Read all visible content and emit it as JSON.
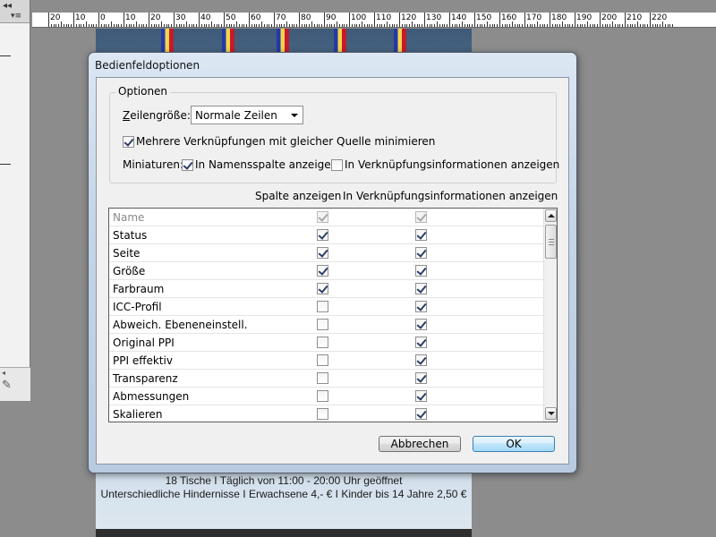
{
  "app": {
    "ruler_ticks": [
      "20",
      "10",
      "0",
      "10",
      "20",
      "30",
      "40",
      "50",
      "60",
      "70",
      "80",
      "90",
      "100",
      "110",
      "120",
      "130",
      "140",
      "150",
      "160",
      "170",
      "180",
      "190",
      "200",
      "210",
      "220"
    ],
    "panel_collapse_glyph": "◂◂",
    "panel_menu_glyph": "▾≡",
    "page_lines": [
      "18 Tische I Täglich von 11:00 - 20:00 Uhr geöffnet",
      "Unterschiedliche Hindernisse I Erwachsene 4,- € I Kinder bis 14 Jahre 2,50 €"
    ]
  },
  "dialog": {
    "title": "Bedienfeldoptionen",
    "options_group": {
      "legend": "Optionen",
      "row_size_label_access": "Z",
      "row_size_label_rest": "eilengröße:",
      "row_size_value": "Normale Zeilen",
      "minimize_links_label": "Mehrere Verknüpfungen mit gleicher Quelle minimieren",
      "minimize_links_checked": true,
      "thumbnails_label": "Miniaturen:",
      "thumb_name_column_label": "In Namensspalte anzeigen",
      "thumb_name_column_checked": true,
      "thumb_link_info_label": "In Verknüpfungsinformationen anzeigen",
      "thumb_link_info_checked": false
    },
    "columns": {
      "show_column": "Spalte anzeigen",
      "show_in_link_info": "In Verknüpfungsinformationen anzeigen"
    },
    "rows": [
      {
        "name": "Name",
        "show_column": true,
        "show_info": true,
        "disabled": true
      },
      {
        "name": "Status",
        "show_column": true,
        "show_info": true,
        "disabled": false
      },
      {
        "name": "Seite",
        "show_column": true,
        "show_info": true,
        "disabled": false
      },
      {
        "name": "Größe",
        "show_column": true,
        "show_info": true,
        "disabled": false
      },
      {
        "name": "Farbraum",
        "show_column": true,
        "show_info": true,
        "disabled": false
      },
      {
        "name": "ICC-Profil",
        "show_column": false,
        "show_info": true,
        "disabled": false
      },
      {
        "name": "Abweich. Ebeneneinstell.",
        "show_column": false,
        "show_info": true,
        "disabled": false
      },
      {
        "name": "Original PPI",
        "show_column": false,
        "show_info": true,
        "disabled": false
      },
      {
        "name": "PPI effektiv",
        "show_column": false,
        "show_info": true,
        "disabled": false
      },
      {
        "name": "Transparenz",
        "show_column": false,
        "show_info": true,
        "disabled": false
      },
      {
        "name": "Abmessungen",
        "show_column": false,
        "show_info": true,
        "disabled": false
      },
      {
        "name": "Skalieren",
        "show_column": false,
        "show_info": true,
        "disabled": false
      }
    ],
    "buttons": {
      "cancel": "Abbrechen",
      "ok": "OK"
    }
  }
}
